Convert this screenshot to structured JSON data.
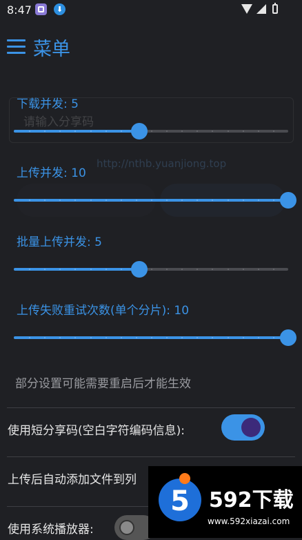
{
  "status_bar": {
    "time": "8:47"
  },
  "header": {
    "title": "菜单"
  },
  "sliders": [
    {
      "label": "下载并发: 5",
      "value": 5,
      "min": 1,
      "max": 10,
      "fraction": 0.4571
    },
    {
      "label": "上传并发: 10",
      "value": 10,
      "min": 1,
      "max": 10,
      "fraction": 1.0
    },
    {
      "label": "批量上传并发: 5",
      "value": 5,
      "min": 1,
      "max": 10,
      "fraction": 0.4571
    },
    {
      "label": "上传失败重试次数(单个分片): 10",
      "value": 10,
      "min": 1,
      "max": 10,
      "fraction": 1.0
    }
  ],
  "note": "部分设置可能需要重启后才能生效",
  "settings": {
    "short_code": {
      "label": "使用短分享码(空白字符编码信息):",
      "enabled": true
    },
    "auto_add": {
      "label": "上传后自动添加文件到\u001c",
      "enabled": true
    },
    "system_player": {
      "label": "使用系统播放器:",
      "enabled": false
    }
  },
  "background": {
    "placeholder": "请输入分享码",
    "link": "http://nthb.yuanjiong.top"
  },
  "watermark": {
    "brand": "592下载",
    "url": "www.592xiazai.com",
    "badge": "5"
  },
  "colors": {
    "accent": "#3b93e6",
    "background": "#1f2024",
    "text": "#e6e6e6"
  }
}
